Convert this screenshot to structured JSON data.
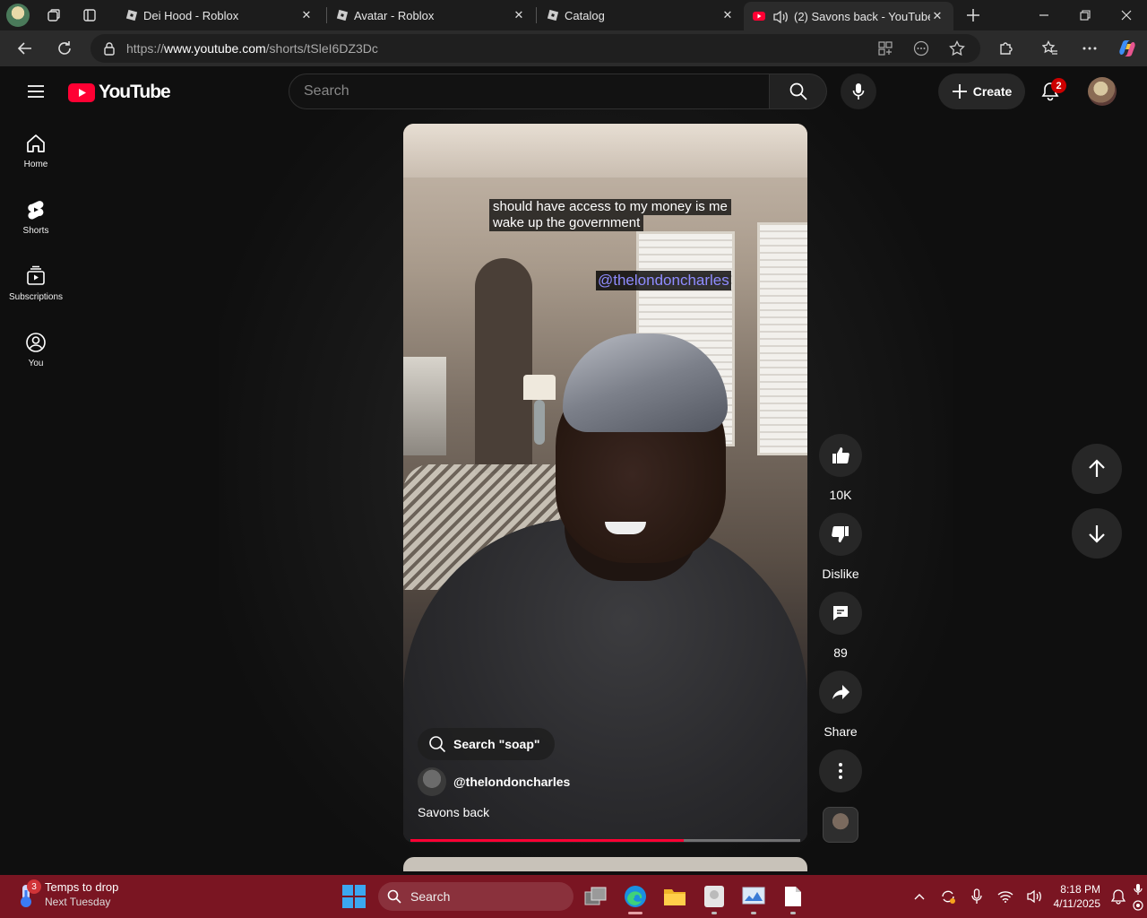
{
  "browser": {
    "tabs": [
      {
        "title": "Dei Hood - Roblox",
        "favicon": "roblox-icon",
        "active": false
      },
      {
        "title": "Avatar - Roblox",
        "favicon": "roblox-icon",
        "active": false
      },
      {
        "title": "Catalog",
        "favicon": "roblox-icon",
        "active": false
      },
      {
        "title": "(2) Savons back - YouTube",
        "favicon": "youtube-icon",
        "active": true
      }
    ],
    "url_prefix": "https://",
    "url_host": "www.youtube.com",
    "url_path": "/shorts/tSleI6DZ3Dc"
  },
  "youtube": {
    "logo_text": "YouTube",
    "search_placeholder": "Search",
    "create_label": "Create",
    "notification_count": "2",
    "guide": [
      {
        "label": "Home",
        "icon": "home-icon"
      },
      {
        "label": "Shorts",
        "icon": "shorts-icon"
      },
      {
        "label": "Subscriptions",
        "icon": "subscriptions-icon"
      },
      {
        "label": "You",
        "icon": "you-icon"
      }
    ],
    "short": {
      "caption_line1": "should have access to my money is me",
      "caption_line2": "wake up the government",
      "watermark": "@thelondoncharles",
      "search_chip": "Search \"soap\"",
      "channel_handle": "@thelondoncharles",
      "title": "Savons back",
      "progress": 0.7
    },
    "actions": {
      "like_count": "10K",
      "dislike_label": "Dislike",
      "comment_count": "89",
      "share_label": "Share"
    }
  },
  "taskbar": {
    "weather_badge": "3",
    "weather_title": "Temps to drop",
    "weather_subtitle": "Next Tuesday",
    "search_label": "Search",
    "time": "8:18 PM",
    "date": "4/11/2025"
  },
  "colors": {
    "yt_red": "#ff0033",
    "taskbar": "#7a1522",
    "page_bg": "#0f0f0f"
  }
}
